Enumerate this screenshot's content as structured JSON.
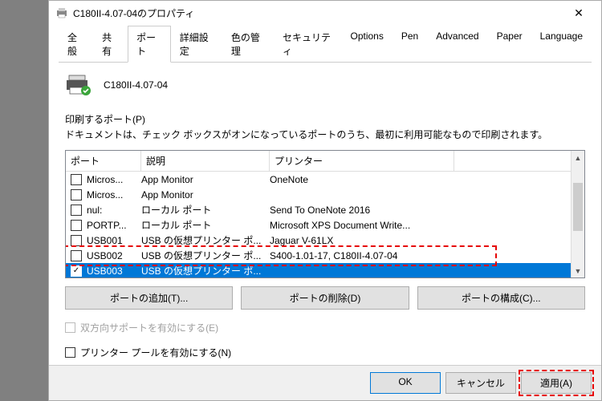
{
  "window": {
    "title": "C180II-4.07-04のプロパティ"
  },
  "tabs": [
    "全般",
    "共有",
    "ポート",
    "詳細設定",
    "色の管理",
    "セキュリティ",
    "Options",
    "Pen",
    "Advanced",
    "Paper",
    "Language"
  ],
  "active_tab_index": 2,
  "device": {
    "name": "C180II-4.07-04"
  },
  "section": {
    "label": "印刷するポート(P)",
    "desc": "ドキュメントは、チェック ボックスがオンになっているポートのうち、最初に利用可能なもので印刷されます。"
  },
  "columns": {
    "port": "ポート",
    "desc": "説明",
    "printer": "プリンター"
  },
  "rows": [
    {
      "checked": false,
      "port": "Micros...",
      "desc": "App Monitor",
      "printer": "OneNote"
    },
    {
      "checked": false,
      "port": "Micros...",
      "desc": "App Monitor",
      "printer": ""
    },
    {
      "checked": false,
      "port": "nul:",
      "desc": "ローカル ポート",
      "printer": "Send To OneNote 2016"
    },
    {
      "checked": false,
      "port": "PORTP...",
      "desc": "ローカル ポート",
      "printer": "Microsoft XPS Document Write..."
    },
    {
      "checked": false,
      "port": "USB001",
      "desc": "USB の仮想プリンター ポ...",
      "printer": "Jaguar V-61LX"
    },
    {
      "checked": false,
      "port": "USB002",
      "desc": "USB の仮想プリンター ポ...",
      "printer": "S400-1.01-17, C180II-4.07-04"
    },
    {
      "checked": true,
      "port": "USB003",
      "desc": "USB の仮想プリンター ポ...",
      "printer": "",
      "selected": true
    }
  ],
  "buttons": {
    "add": "ポートの追加(T)...",
    "del": "ポートの削除(D)",
    "cfg": "ポートの構成(C)..."
  },
  "checks": {
    "bidi": "双方向サポートを有効にする(E)",
    "pool": "プリンター プールを有効にする(N)"
  },
  "footer": {
    "ok": "OK",
    "cancel": "キャンセル",
    "apply": "適用(A)"
  }
}
